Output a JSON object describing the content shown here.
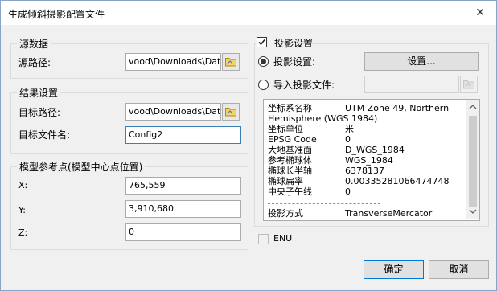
{
  "window": {
    "title": "生成倾斜摄影配置文件",
    "close_glyph": "✕"
  },
  "source": {
    "legend": "源数据",
    "path_label": "源路径:",
    "path_value": "vood\\Downloads\\Data",
    "browse_icon": "folder-icon"
  },
  "result": {
    "legend": "结果设置",
    "target_path_label": "目标路径:",
    "target_path_value": "vood\\Downloads\\Data",
    "target_name_label": "目标文件名:",
    "target_name_value": "Config2",
    "browse_icon": "folder-icon"
  },
  "refpoint": {
    "legend": "模型参考点(模型中心点位置)",
    "x_label": "X:",
    "x_value": "765,559",
    "y_label": "Y:",
    "y_value": "3,910,680",
    "z_label": "Z:",
    "z_value": "0"
  },
  "projection": {
    "legend": "投影设置",
    "enabled": true,
    "option_settings_label": "投影设置:",
    "settings_button": "设置...",
    "option_file_label": "导入投影文件:",
    "file_value": "",
    "selected": "settings",
    "info_rows": [
      {
        "key": "坐标系名称",
        "value": "UTM Zone 49, Northern"
      },
      {
        "key": "Hemisphere (WGS 1984)",
        "value": ""
      },
      {
        "key": "坐标单位",
        "value": "米"
      },
      {
        "key": "EPSG Code",
        "value": "0"
      },
      {
        "key": "大地基准面",
        "value": "D_WGS_1984"
      },
      {
        "key": "参考椭球体",
        "value": "WGS_1984"
      },
      {
        "key": "椭球长半轴",
        "value": "6378137"
      },
      {
        "key": "椭球扁率",
        "value": "0.00335281066474748"
      },
      {
        "key": "中央子午线",
        "value": "0"
      },
      {
        "key": "投影方式",
        "value": "TransverseMercator"
      }
    ]
  },
  "enu": {
    "label": "ENU",
    "checked": false
  },
  "buttons": {
    "ok": "确定",
    "cancel": "取消"
  }
}
